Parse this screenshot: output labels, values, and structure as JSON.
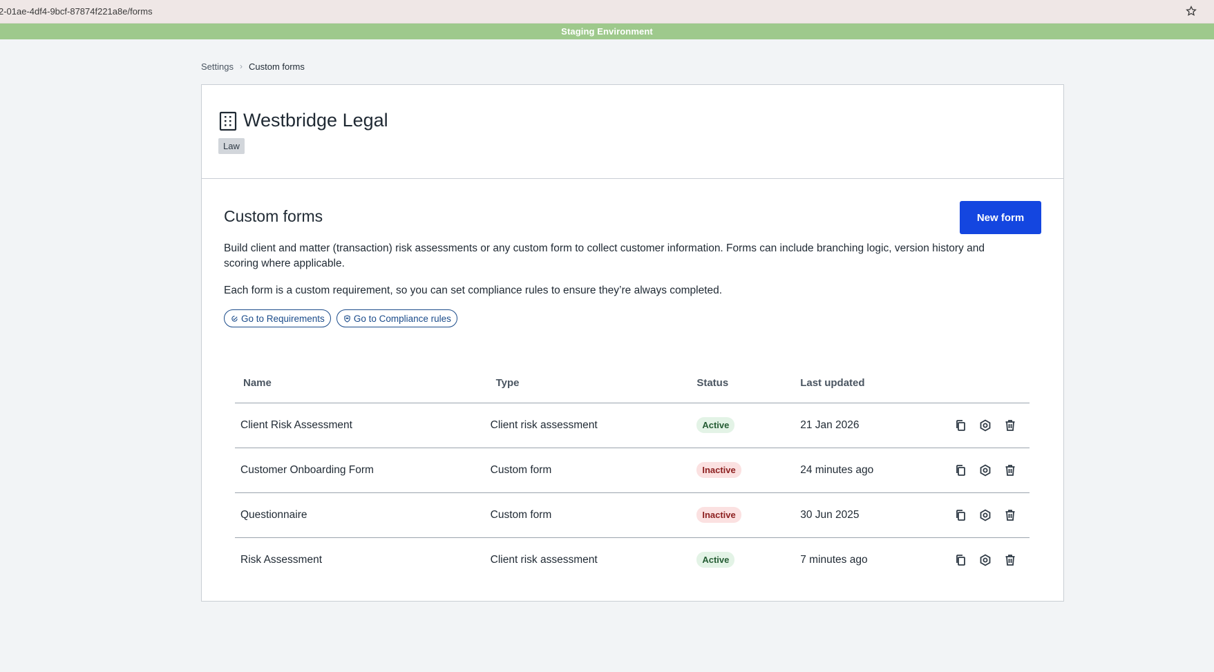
{
  "browser": {
    "url": "2-01ae-4df4-9bcf-87874f221a8e/forms"
  },
  "banner": {
    "text": "Staging Environment",
    "color": "#9ec98c"
  },
  "breadcrumb": {
    "items": [
      "Settings",
      "Custom forms"
    ]
  },
  "organization": {
    "name": "Westbridge Legal",
    "tag": "Law",
    "icon": "building-icon"
  },
  "section": {
    "title": "Custom forms",
    "new_form_label": "New form",
    "description": "Build client and matter (transaction) risk assessments or any custom form to collect customer information. Forms can include branching logic, version history and scoring where applicable.",
    "description2": "Each form is a custom requirement, so you can set compliance rules to ensure they’re always completed.",
    "links": [
      {
        "label": "Go to Requirements",
        "icon": "requirements-icon"
      },
      {
        "label": "Go to Compliance rules",
        "icon": "shield-icon"
      }
    ]
  },
  "table": {
    "headers": [
      "Name",
      "Type",
      "Status",
      "Last updated"
    ],
    "rows": [
      {
        "name": "Client Risk Assessment",
        "type": "Client risk assessment",
        "status": "Active",
        "updated": "21 Jan 2026"
      },
      {
        "name": "Customer Onboarding Form",
        "type": "Custom form",
        "status": "Inactive",
        "updated": "24 minutes ago"
      },
      {
        "name": "Questionnaire",
        "type": "Custom form",
        "status": "Inactive",
        "updated": "30 Jun 2025"
      },
      {
        "name": "Risk Assessment",
        "type": "Client risk assessment",
        "status": "Active",
        "updated": "7 minutes ago"
      }
    ],
    "row_actions": [
      "copy-icon",
      "settings-icon",
      "trash-icon"
    ]
  },
  "colors": {
    "primary_button": "#1446e0",
    "active_badge": "#e3f3e6",
    "inactive_badge": "#fbe1e1"
  }
}
